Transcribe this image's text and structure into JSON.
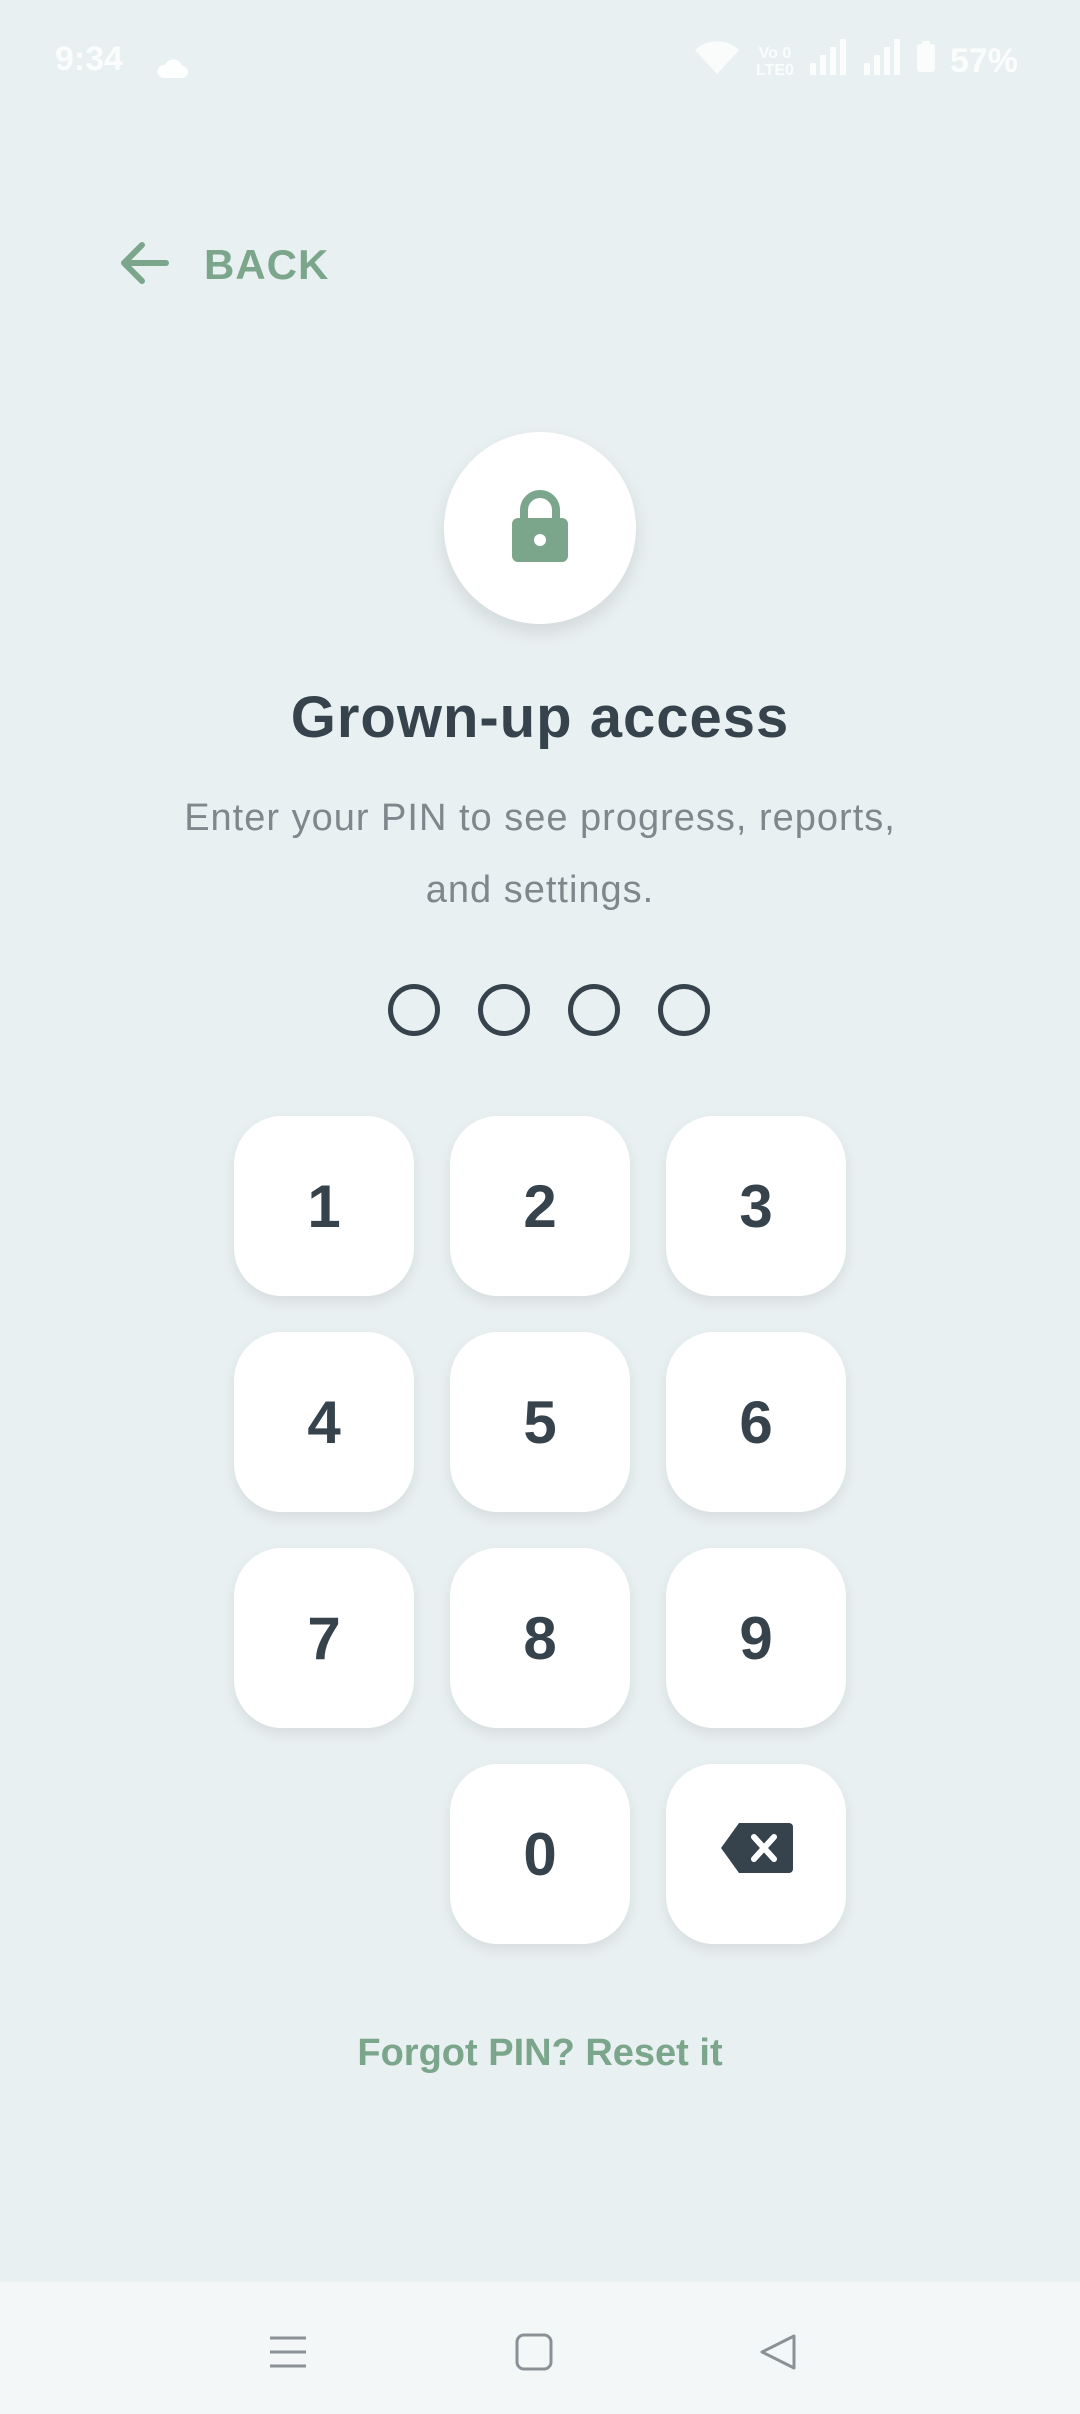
{
  "status_bar": {
    "time": "9:34",
    "network_label": "Vo 0\nLTE0",
    "battery": "57%",
    "icons": [
      "cloud-icon",
      "wifi-icon",
      "volte-icon",
      "signal-icon",
      "signal-icon",
      "battery-icon"
    ]
  },
  "header": {
    "back_label": "BACK",
    "back_icon": "arrow-left-icon"
  },
  "lock": {
    "icon": "lock-icon"
  },
  "title": "Grown-up access",
  "subtitle": "Enter your PIN to see progress, reports, and settings.",
  "pin": {
    "length": 4,
    "entered": 0
  },
  "keypad": {
    "keys": [
      "1",
      "2",
      "3",
      "4",
      "5",
      "6",
      "7",
      "8",
      "9",
      "0"
    ],
    "delete_icon": "backspace-icon"
  },
  "forgot_link": "Forgot PIN? Reset it",
  "nav_bar": {
    "icons": [
      "menu-icon",
      "home-icon",
      "back-triangle-icon"
    ]
  },
  "colors": {
    "background": "#E9F0F1",
    "accent": "#7BA68B",
    "text_dark": "#36434C",
    "text_muted": "#7D878C",
    "key_bg": "#FFFFFF"
  }
}
